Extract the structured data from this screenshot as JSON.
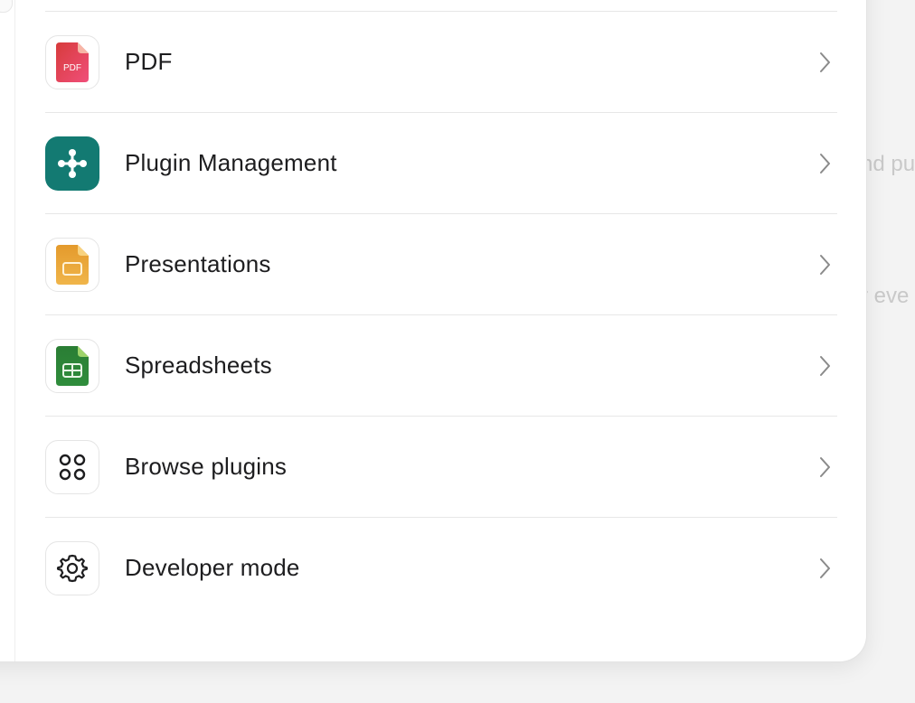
{
  "background": {
    "text_1": "nd pu",
    "text_2": "r eve"
  },
  "menu": {
    "items": [
      {
        "label": "PDF",
        "icon": "pdf-icon",
        "icon_text": "PDF"
      },
      {
        "label": "Plugin Management",
        "icon": "plugin-management-icon"
      },
      {
        "label": "Presentations",
        "icon": "presentations-icon"
      },
      {
        "label": "Spreadsheets",
        "icon": "spreadsheets-icon"
      },
      {
        "label": "Browse plugins",
        "icon": "grid-circles-icon"
      },
      {
        "label": "Developer mode",
        "icon": "gear-icon"
      }
    ]
  },
  "colors": {
    "pdf": "#e8485f",
    "plugin": "#137a72",
    "presentations": "#eaa43a",
    "spreadsheets": "#2f8d3c",
    "chevron": "#8a8a8a"
  }
}
